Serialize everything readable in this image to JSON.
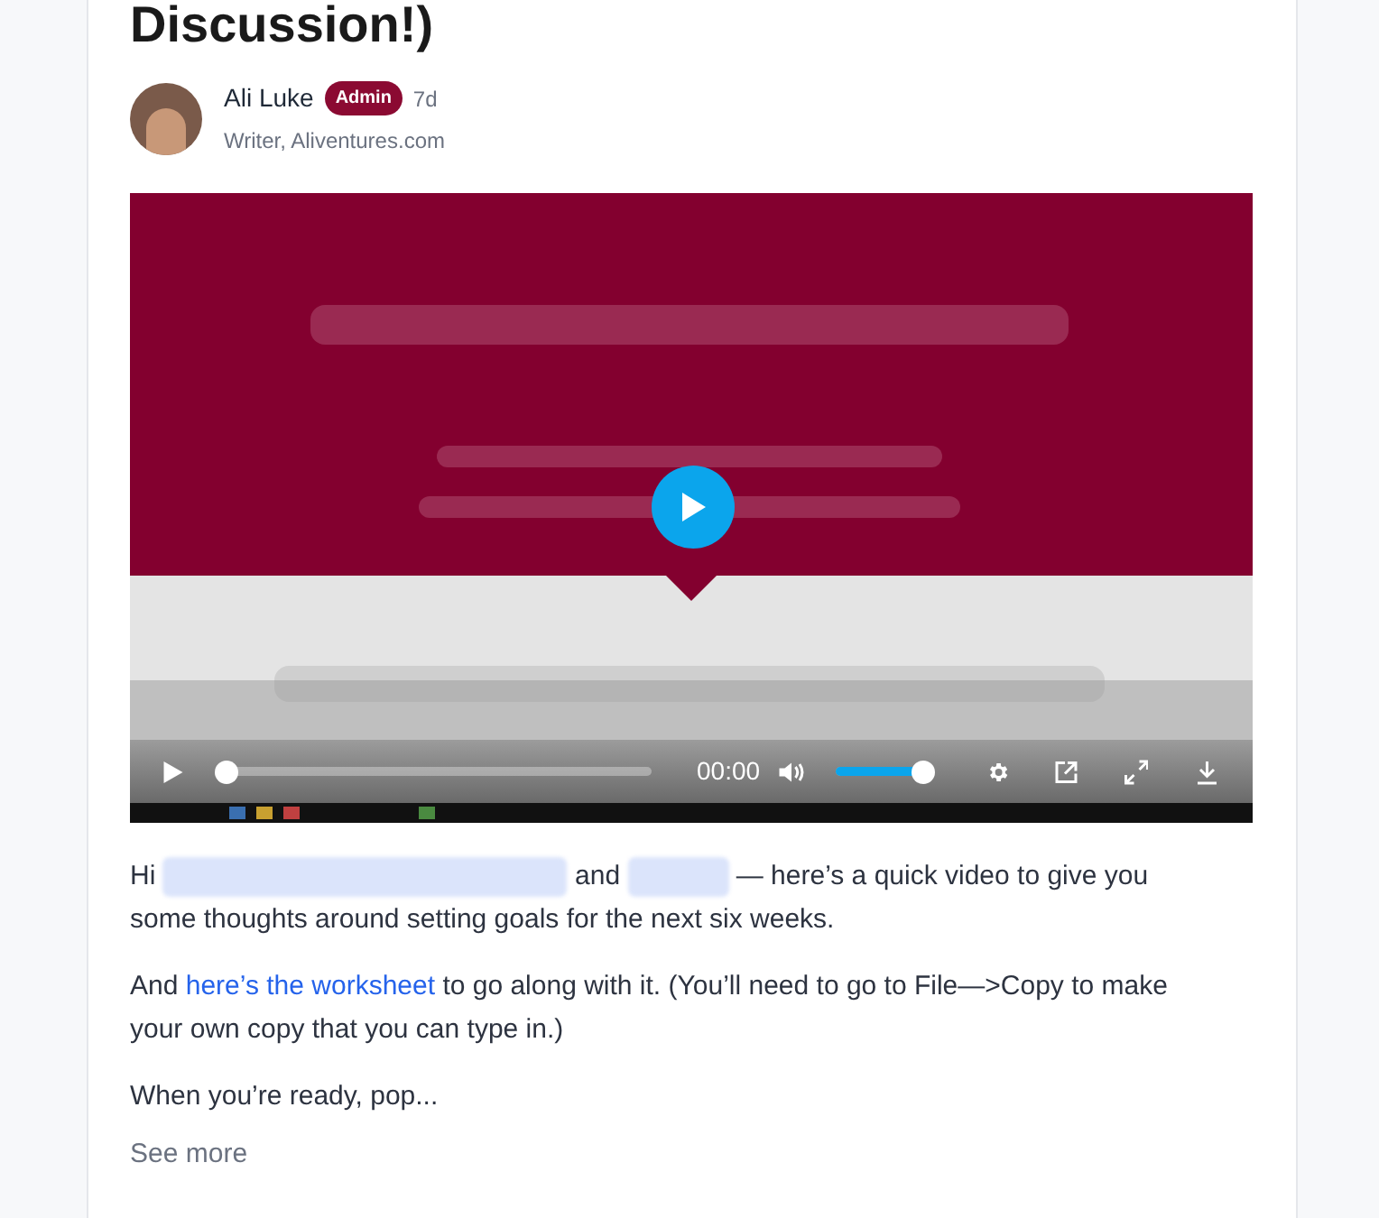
{
  "post": {
    "title": "Discussion!)",
    "author": {
      "name": "Ali Luke",
      "badge": "Admin",
      "time": "7d",
      "subtitle": "Writer, Aliventures.com"
    },
    "video": {
      "kind": "picture",
      "progress": {
        "level": 0
      },
      "time": "00:00",
      "volume": {
        "level": 1
      }
    },
    "paragraphs": [
      {
        "segments": [
          "Hi",
          "and",
          "— here’s a quick video to give you some thoughts around setting goals for the next six weeks."
        ]
      },
      {
        "before": "And",
        "link": "here’s the worksheet",
        "after": "to go along with it. (You’ll need to go to File—>Copy to make your own copy that you can type in.)"
      },
      {
        "text": "When you’re ready, pop..."
      }
    ],
    "see_more": "See more"
  }
}
